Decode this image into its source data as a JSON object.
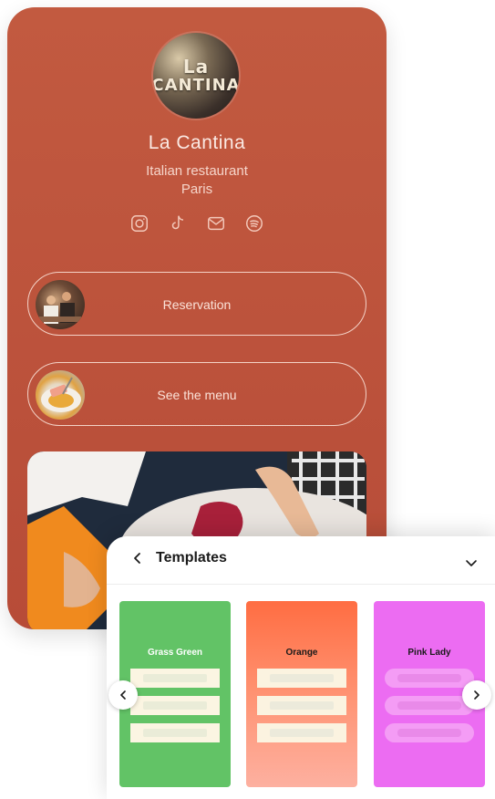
{
  "profile": {
    "logo_text_1": "La",
    "logo_text_2": "CANTINA",
    "name": "La Cantina",
    "subtitle_1": "Italian restaurant",
    "subtitle_2": "Paris",
    "social_icons": [
      "instagram-icon",
      "tiktok-icon",
      "mail-icon",
      "spotify-icon"
    ]
  },
  "links": [
    {
      "label": "Reservation"
    },
    {
      "label": "See the menu"
    }
  ],
  "templates_panel": {
    "title": "Templates",
    "cards": [
      {
        "name": "Grass Green",
        "color": "#62c366",
        "name_color": "#ffffff"
      },
      {
        "name": "Orange",
        "color": "#ff7a52",
        "name_color": "#1a1a1a"
      },
      {
        "name": "Pink Lady",
        "color": "#ec6cf2",
        "name_color": "#1a1a1a"
      }
    ]
  },
  "colors": {
    "brand_background": "#b9503b",
    "text_light": "#fbe9e3"
  }
}
